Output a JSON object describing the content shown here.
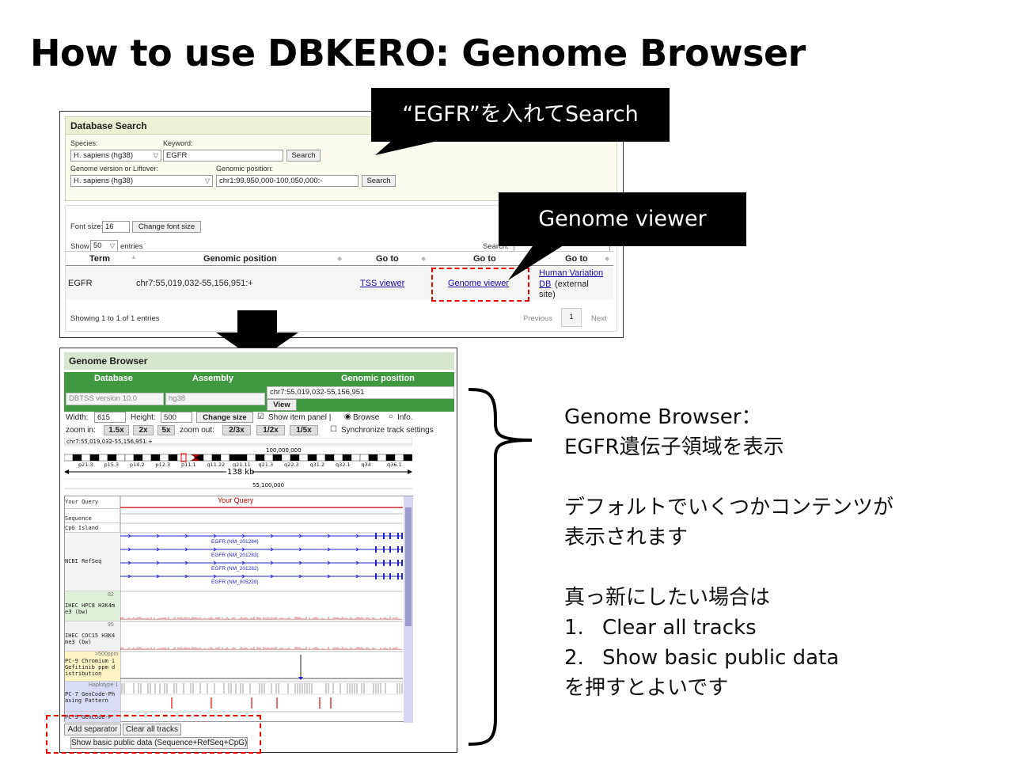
{
  "slide": {
    "title": "How to use DBKERO: Genome Browser"
  },
  "db_search": {
    "header": "Database Search",
    "species_label": "Species:",
    "species_value": "H. sapiens (hg38)",
    "keyword_label": "Keyword:",
    "keyword_value": "EGFR",
    "search_button": "Search",
    "genome_version_label": "Genome version or Liftover:",
    "genome_version_value": "H. sapiens (hg38)",
    "genomic_position_label": "Genomic position:",
    "genomic_position_value": "chr1:99,950,000-100,050,000:-",
    "search_button2": "Search",
    "font_size_label": "Font size:",
    "font_size_value": "16",
    "change_font_button": "Change font size",
    "show_label": "Show",
    "show_value": "50",
    "entries_label": "entries",
    "search_label": "Search:",
    "columns": [
      "Term",
      "Genomic position",
      "Go to",
      "Go to",
      "Go to"
    ],
    "row": {
      "term": "EGFR",
      "position": "chr7:55,019,032-55,156,951:+",
      "tss": "TSS viewer",
      "genome": "Genome viewer",
      "hv_link1": "Human Variation",
      "hv_link2": "DB",
      "hv_rest1": "(external",
      "hv_rest2": "site)"
    },
    "showing": "Showing 1 to 1 of 1 entries",
    "previous": "Previous",
    "page": "1",
    "next": "Next"
  },
  "callouts": {
    "search": "“EGFR”を入れてSearch",
    "viewer": "Genome viewer"
  },
  "genome_browser": {
    "header": "Genome Browser",
    "tabs": [
      "Database",
      "Assembly",
      "Genomic position"
    ],
    "database_value": "DBTSS version 10.0",
    "assembly_value": "hg38",
    "position_value": "chr7:55,019,032-55,156,951",
    "view_button": "View",
    "width_label": "Width:",
    "width_value": "615",
    "height_label": "Height:",
    "height_value": "500",
    "change_size": "Change size",
    "show_item_panel": "Show item panel |",
    "browse": "Browse",
    "info": "Info.",
    "zoom_in": "zoom in:",
    "zoom_in_buttons": [
      "1.5x",
      "2x",
      "5x"
    ],
    "zoom_out": "zoom out:",
    "zoom_out_buttons": [
      "2/3x",
      "1/2x",
      "1/5x"
    ],
    "sync": "Synchronize track settings",
    "ideogram_pos": "chr7:55,019,032-55,156,951:+",
    "ideogram_mark": "100,000,000",
    "bands": [
      "p21.3",
      "p15.3",
      "p14.2",
      "p12.3",
      "p11.1",
      "q11.22",
      "q21.11",
      "q21.3",
      "q22.3",
      "q31.2",
      "q32.1",
      "q34",
      "q36.1"
    ],
    "scale": "138 kb",
    "coord": "55,100,000",
    "your_query": "Your Query",
    "track_labels": {
      "query": "Your Query",
      "sequence": "Sequence",
      "cpg": "CpG Island",
      "refseq": "NCBI RefSeq",
      "h3k4_1": "IHEC HPC8 H3K4m e3 (bw)",
      "h3k4_2": "IHEC COC15 H3K4 me3 (bw)",
      "pc9": "PC-9 Chromium i Gefitinib ppm d istribution",
      "pc7": "PC-7 GenCode-Ph asing Pattern",
      "pc9b": "PC-9 GenCode-P"
    },
    "peaks": {
      "h3k4_1": "82",
      "h3k4_2": "95",
      "pc9": ">500ppm",
      "pc7": "Haplotype 1"
    },
    "transcripts": [
      "EGFR (NM_201284)",
      "EGFR (NM_201283)",
      "EGFR (NM_201282)",
      "EGFR (NM_005228)"
    ],
    "add_separator": "Add separator",
    "clear_all": "Clear all tracks",
    "show_basic": "Show basic public data (Sequence+RefSeq+CpG)"
  },
  "description": {
    "line1": "Genome Browser：",
    "line2": "EGFR遺伝子領域を表示",
    "line3": "デフォルトでいくつかコンテンツが",
    "line4": "表示されます",
    "line5": "真っ新にしたい場合は",
    "item1_num": "1.",
    "item1": "Clear all tracks",
    "item2_num": "2.",
    "item2": "Show basic public data",
    "line6": "を押すとよいです"
  },
  "colors": {
    "accent_red": "#e00000",
    "browser_green": "#3f9a3f",
    "link_blue": "#1a0dab"
  }
}
